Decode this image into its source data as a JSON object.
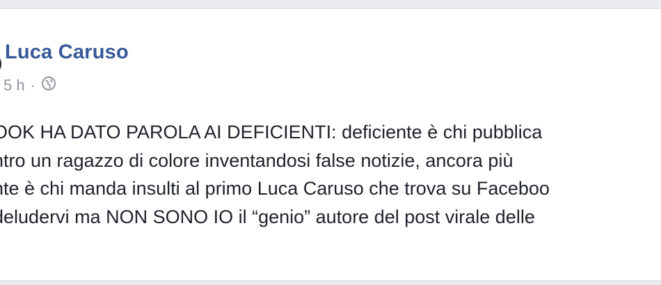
{
  "post": {
    "author": "Luca Caruso",
    "time": "5 h",
    "separator": "·",
    "privacy_icon": "globe-icon",
    "lines": [
      "OOK HA DATO PAROLA AI DEFICIENTI: deficiente è chi pubblica",
      "ntro un ragazzo di colore inventandosi false notizie, ancora più",
      "nte è chi manda insulti al primo Luca Caruso che trova su Faceboo",
      "deludervi ma NON SONO IO il “genio” autore del post virale delle"
    ]
  },
  "colors": {
    "author": "#365899",
    "meta": "#90949c",
    "text": "#1d2129",
    "background": "#e9ebee"
  }
}
